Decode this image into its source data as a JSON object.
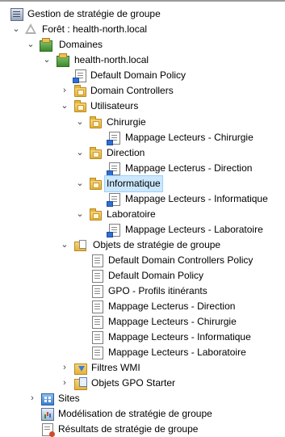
{
  "tree": {
    "root": "Gestion de stratégie de groupe",
    "forest": "Forêt : health-north.local",
    "domains": "Domaines",
    "domain": "health-north.local",
    "default_domain_policy": "Default Domain Policy",
    "domain_controllers": "Domain Controllers",
    "utilisateurs": "Utilisateurs",
    "chirurgie": "Chirurgie",
    "chirurgie_gpo": "Mappage Lecteurs - Chirurgie",
    "direction": "Direction",
    "direction_gpo": "Mappage Lecterus - Direction",
    "informatique": "Informatique",
    "informatique_gpo": "Mappage Lecteurs - Informatique",
    "laboratoire": "Laboratoire",
    "laboratoire_gpo": "Mappage Lecteurs - Laboratoire",
    "gpo_objects": "Objets de stratégie de groupe",
    "gpo_list": [
      "Default Domain Controllers Policy",
      "Default Domain Policy",
      "GPO - Profils itinérants",
      "Mappage Lecterus - Direction",
      "Mappage Lecteurs - Chirurgie",
      "Mappage Lecteurs - Informatique",
      "Mappage Lecteurs - Laboratoire"
    ],
    "wmi_filters": "Filtres WMI",
    "starter_gpos": "Objets GPO Starter",
    "sites": "Sites",
    "modeling": "Modélisation de stratégie de groupe",
    "results": "Résultats de stratégie de groupe"
  },
  "selected": "Informatique",
  "colors": {
    "selection": "#cce8ff",
    "selection_border": "#99d1ff"
  }
}
